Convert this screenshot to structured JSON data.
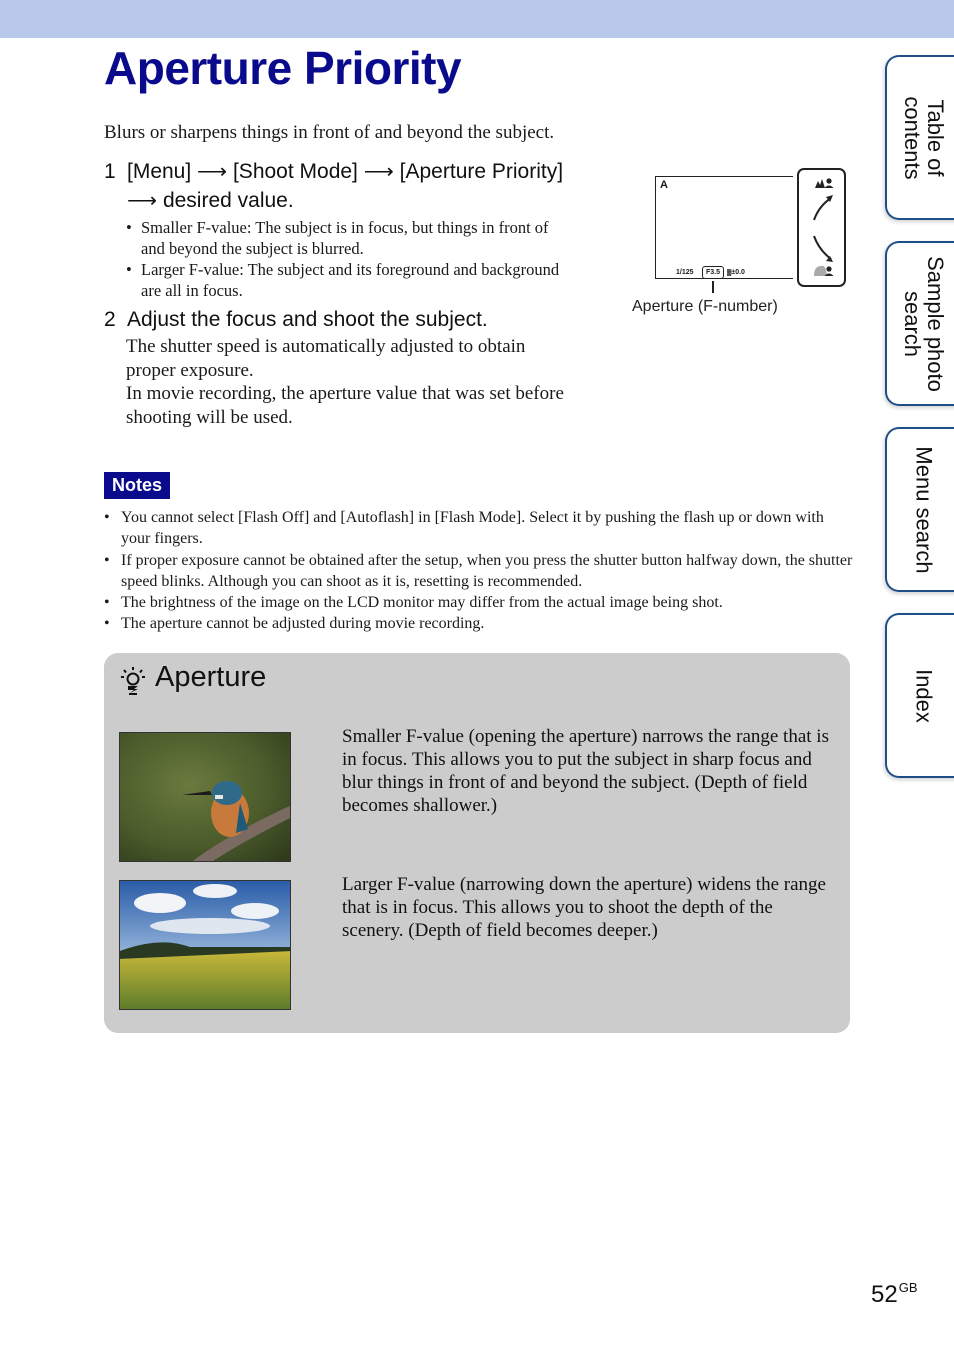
{
  "page": {
    "title": "Aperture Priority",
    "intro": "Blurs or sharpens things in front of and beyond the subject.",
    "page_number": "52",
    "page_suffix": "GB"
  },
  "steps": [
    {
      "number": "1",
      "text": "[Menu] ⟶ [Shoot Mode] ⟶ [Aperture Priority] ⟶ desired value.",
      "bullets": [
        "Smaller F-value: The subject is in focus, but things in front of and beyond the subject is blurred.",
        "Larger F-value: The subject and its foreground and background are all in focus."
      ]
    },
    {
      "number": "2",
      "text": "Adjust the focus and shoot the subject.",
      "body": [
        "The shutter speed is automatically adjusted to obtain proper exposure.",
        "In movie recording, the aperture value that was set before shooting will be used."
      ]
    }
  ],
  "lcd_diagram": {
    "mode": "A",
    "shutter_speed": "1/125",
    "f_number": "F3.5",
    "exposure": "±0.0",
    "caption": "Aperture (F-number)",
    "dial_icons": [
      "deep-focus-icon",
      "shallow-focus-icon"
    ]
  },
  "notes": {
    "label": "Notes",
    "items": [
      "You cannot select [Flash Off] and [Autoflash] in [Flash Mode]. Select it by pushing the flash up or down with your fingers.",
      "If proper exposure cannot be obtained after the setup, when you press the shutter button halfway down, the shutter speed blinks. Although you can shoot as it is, resetting is recommended.",
      "The brightness of the image on the LCD monitor may differ from the actual image being shot.",
      "The aperture cannot be adjusted during movie recording."
    ]
  },
  "tip": {
    "title": "Aperture",
    "icon": "lightbulb-hint-icon",
    "items": [
      {
        "image": "kingfisher-photo",
        "text": "Smaller F-value (opening the aperture) narrows the range that is in focus. This allows you to put the subject in sharp focus and blur things in front of and beyond the subject. (Depth of field becomes shallower.)"
      },
      {
        "image": "sunflower-field-photo",
        "text": "Larger F-value (narrowing down the aperture) widens the range that is in focus. This allows you to shoot the depth of the scenery. (Depth of field becomes deeper.)"
      }
    ]
  },
  "side_tabs": [
    {
      "label": "Table of\ncontents"
    },
    {
      "label": "Sample photo\nsearch"
    },
    {
      "label": "Menu search"
    },
    {
      "label": "Index"
    }
  ],
  "colors": {
    "title_blue": "#0a0a8c",
    "top_band": "#b8c8ea",
    "tip_box_bg": "#cccccc",
    "tab_border": "#1e4f8a"
  }
}
